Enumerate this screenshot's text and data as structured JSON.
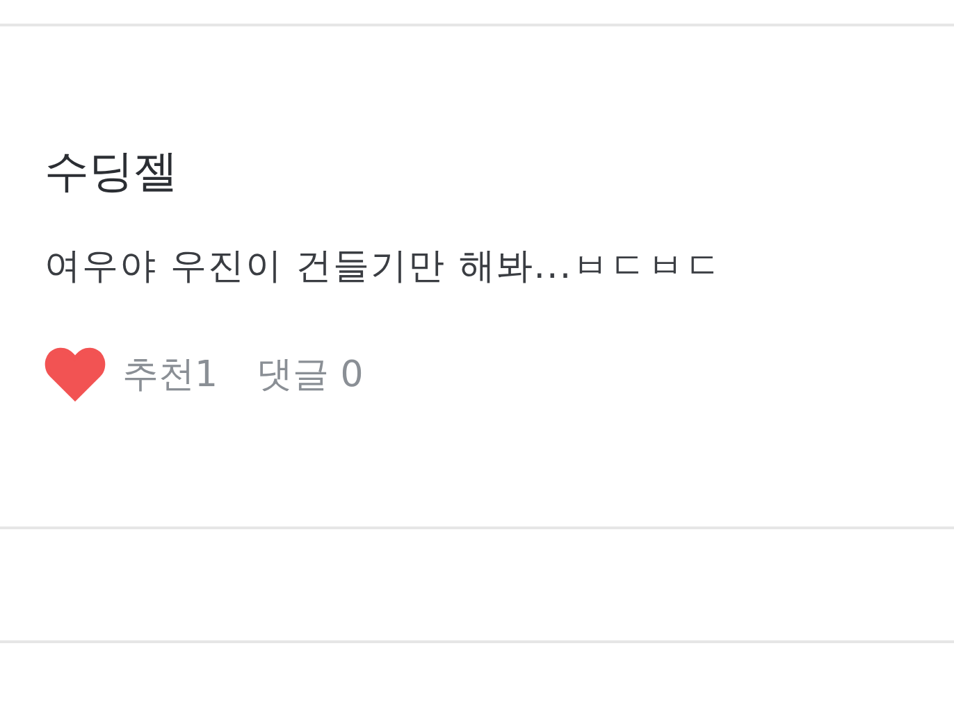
{
  "post": {
    "author": "수딩젤",
    "body": "여우야 우진이 건들기만 해봐...ㅂㄷㅂㄷ",
    "liked": true,
    "recommend": "추천1",
    "comments": "댓글 0"
  }
}
